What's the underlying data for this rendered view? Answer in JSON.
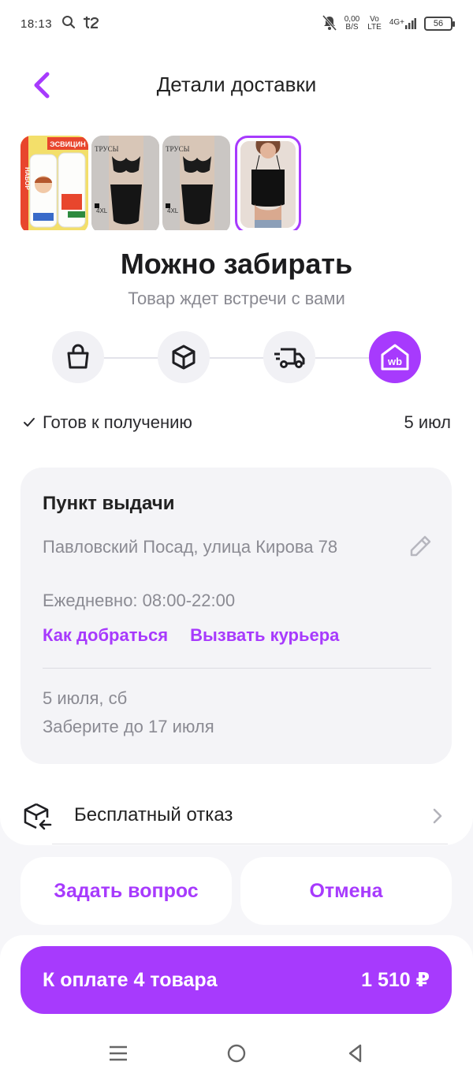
{
  "status_bar": {
    "time": "18:13",
    "carrier_icon": "t2-logo-icon",
    "net_speed_value": "0,00",
    "net_speed_unit": "B/S",
    "volte_top": "Vo",
    "volte_bottom": "LTE",
    "network": "4G+",
    "battery": "56"
  },
  "header": {
    "title": "Детали доставки"
  },
  "thumbnails": [
    {
      "caption": "ЭСВИЦИН",
      "side": "НАБОР"
    },
    {
      "caption": "ТРУСЫ",
      "size": "4XL"
    },
    {
      "caption": "ТРУСЫ",
      "size": "4XL"
    },
    {
      "caption": ""
    }
  ],
  "status": {
    "title": "Можно забирать",
    "subtitle": "Товар ждет встречи с вами",
    "steps": [
      {
        "icon": "shopping-bag-icon"
      },
      {
        "icon": "box-icon"
      },
      {
        "icon": "delivery-truck-icon"
      },
      {
        "icon": "wb-pickup-point-icon",
        "active_label": "wb"
      }
    ],
    "ready_label": "Готов к получению",
    "ready_date": "5 июл"
  },
  "pickup": {
    "title": "Пункт выдачи",
    "address": "Павловский Посад, улица Кирова 78",
    "hours": "Ежедневно: 08:00-22:00",
    "link_route": "Как добраться",
    "link_courier": "Вызвать курьера",
    "date": "5 июля, сб",
    "deadline": "Заберите до 17 июля"
  },
  "refusal": {
    "label": "Бесплатный отказ"
  },
  "actions": {
    "ask": "Задать вопрос",
    "cancel": "Отмена",
    "pay_label": "К оплате 4 товара",
    "pay_amount": "1 510 ₽"
  },
  "colors": {
    "accent": "#a73afd",
    "muted_text": "#8b8b93",
    "card_bg": "#f4f4f7"
  }
}
